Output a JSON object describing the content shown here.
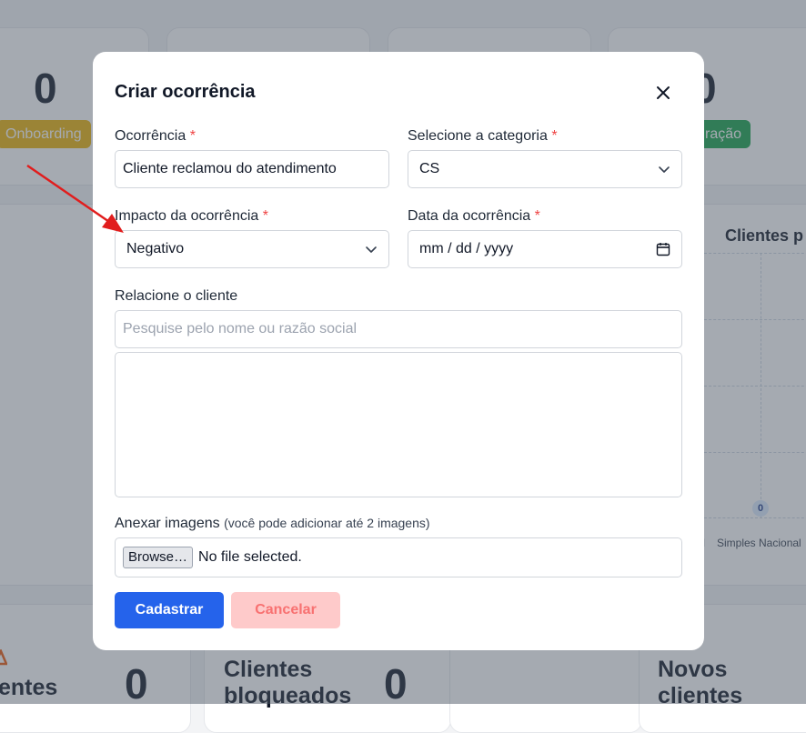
{
  "background": {
    "stats": [
      {
        "value": "0",
        "badge": "Onboarding",
        "badge_color": "#eab308"
      },
      {
        "value": "0",
        "badge": "ração",
        "badge_color": "#16a34a"
      }
    ],
    "chart": {
      "title": "Clientes p",
      "value_label": "0",
      "tick_left": "I",
      "tick_label": "Simples Nacional"
    },
    "bottom_cards": [
      {
        "label": "entes",
        "value": "0"
      },
      {
        "label": "Clientes bloqueados",
        "value": "0"
      },
      {
        "label": "Novos clientes"
      }
    ]
  },
  "modal": {
    "title": "Criar ocorrência",
    "fields": {
      "ocorrencia": {
        "label": "Ocorrência",
        "required": "*",
        "value": "Cliente reclamou do atendimento"
      },
      "categoria": {
        "label": "Selecione a categoria",
        "required": "*",
        "value": "CS"
      },
      "impacto": {
        "label": "Impacto da ocorrência",
        "required": "*",
        "value": "Negativo"
      },
      "data": {
        "label": "Data da ocorrência",
        "required": "*",
        "value": "mm / dd / yyyy"
      },
      "cliente": {
        "label": "Relacione o cliente",
        "placeholder": "Pesquise pelo nome ou razão social"
      },
      "imagens": {
        "label": "Anexar imagens",
        "hint": "(você pode adicionar até 2 imagens)",
        "browse_label": "Browse…",
        "file_status": "No file selected."
      }
    },
    "buttons": {
      "submit": "Cadastrar",
      "cancel": "Cancelar"
    }
  },
  "colors": {
    "primary": "#2563eb",
    "danger_light": "#fecaca",
    "required": "#ef4444",
    "annotation_arrow": "#e11d1d"
  },
  "icons": [
    "close-icon",
    "chevron-down-icon",
    "calendar-icon",
    "warning-icon",
    "annotation-arrow"
  ]
}
